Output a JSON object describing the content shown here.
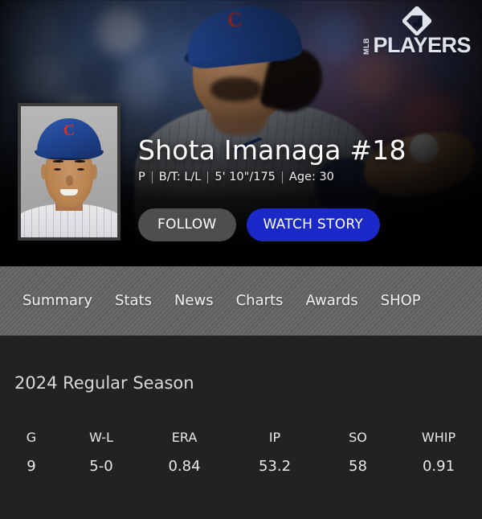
{
  "brand": {
    "logo_mark": "diamond-icon",
    "logo_mlb": "MLB",
    "logo_players": "PLAYERS"
  },
  "hero": {
    "headshot_alt": "player-headshot",
    "player_name": "Shota Imanaga #18",
    "meta": {
      "position": "P",
      "bats_throws": "B/T: L/L",
      "height_weight": "5' 10\"/175",
      "age": "Age: 30"
    },
    "actions": {
      "follow_label": "FOLLOW",
      "watch_label": "WATCH STORY",
      "follow_color": "#4e4e4e",
      "watch_color": "#1a29c8"
    }
  },
  "nav": {
    "tabs": [
      {
        "label": "Summary",
        "active": true
      },
      {
        "label": "Stats",
        "active": false
      },
      {
        "label": "News",
        "active": false
      },
      {
        "label": "Charts",
        "active": false
      },
      {
        "label": "Awards",
        "active": false
      },
      {
        "label": "SHOP",
        "active": false
      }
    ]
  },
  "main": {
    "section_title": "2024 Regular Season",
    "stats": {
      "headers": [
        "G",
        "W-L",
        "ERA",
        "IP",
        "SO",
        "WHIP"
      ],
      "values": [
        "9",
        "5-0",
        "0.84",
        "53.2",
        "58",
        "0.91"
      ]
    }
  },
  "colors": {
    "page_background": "#222222",
    "nav_background": "#646464",
    "accent_blue": "#1a29c8",
    "text_primary": "#ffffff"
  }
}
